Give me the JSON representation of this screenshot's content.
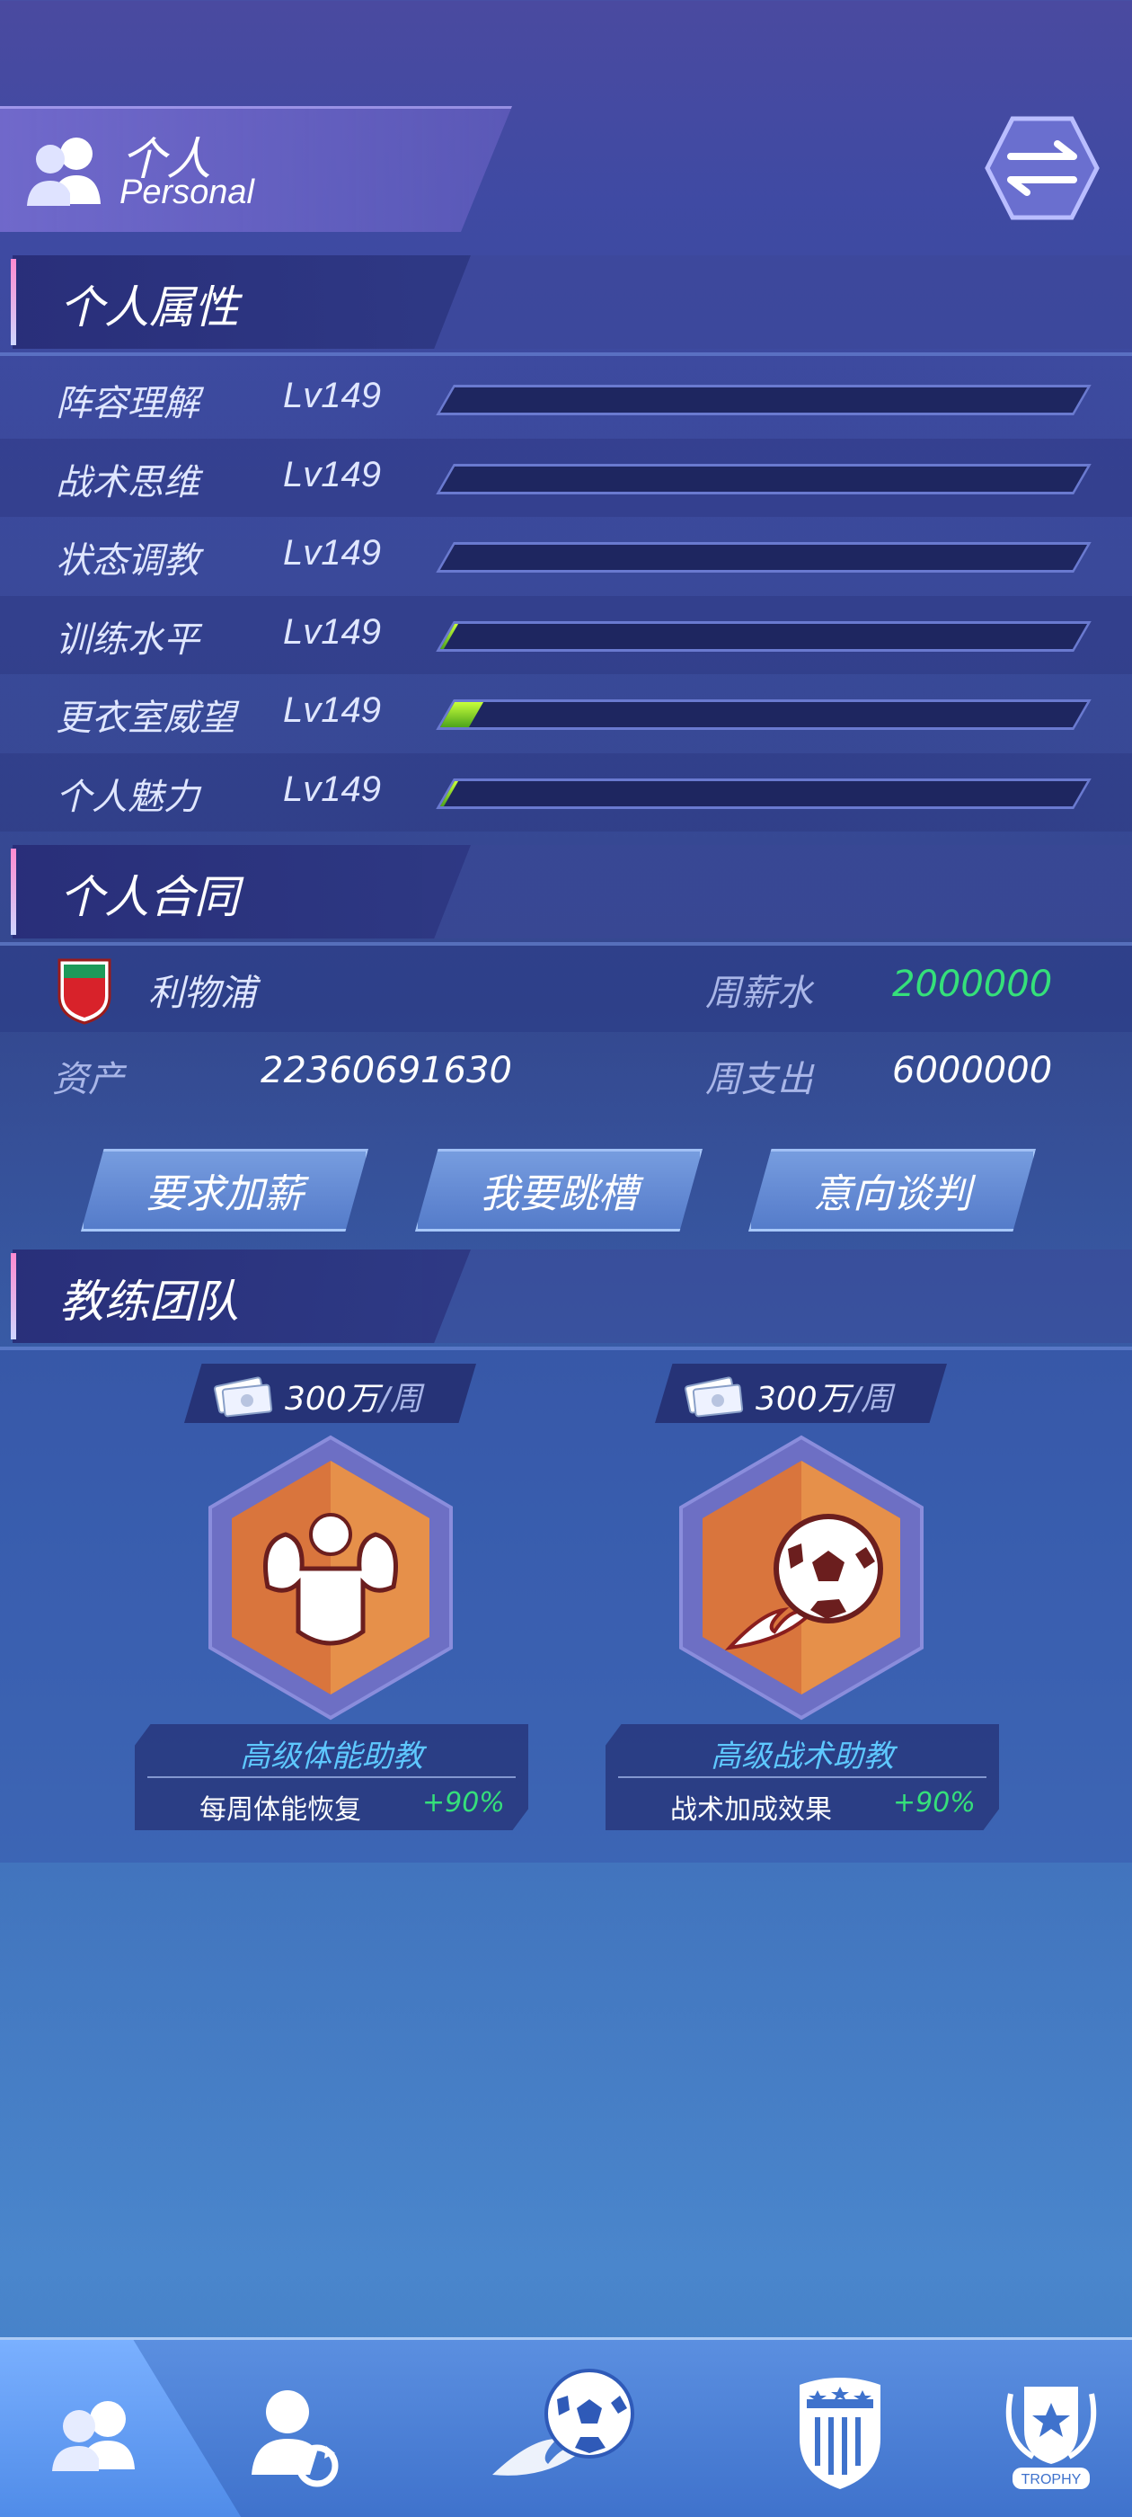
{
  "header": {
    "title": "个人",
    "subtitle": "Personal"
  },
  "sections": {
    "attributes": "个人属性",
    "contract": "个人合同",
    "coaches": "教练团队"
  },
  "attributes": [
    {
      "name": "阵容理解",
      "level": "Lv149",
      "progress": 0.0
    },
    {
      "name": "战术思维",
      "level": "Lv149",
      "progress": 0.0
    },
    {
      "name": "状态调教",
      "level": "Lv149",
      "progress": 0.0
    },
    {
      "name": "训练水平",
      "level": "Lv149",
      "progress": 0.005
    },
    {
      "name": "更衣室威望",
      "level": "Lv149",
      "progress": 0.045
    },
    {
      "name": "个人魅力",
      "level": "Lv149",
      "progress": 0.005
    }
  ],
  "contract": {
    "club": "利物浦",
    "weekly_salary_label": "周薪水",
    "weekly_salary": "2000000",
    "assets_label": "资产",
    "assets": "22360691630",
    "weekly_expense_label": "周支出",
    "weekly_expense": "6000000"
  },
  "actions": {
    "raise": "要求加薪",
    "transfer": "我要跳槽",
    "negotiate": "意向谈判"
  },
  "coaches": [
    {
      "cost": "300万",
      "unit": "/周",
      "name": "高级体能助教",
      "effect": "每周体能恢复",
      "bonus": "+90%",
      "icon": "muscle-icon"
    },
    {
      "cost": "300万",
      "unit": "/周",
      "name": "高级战术助教",
      "effect": "战术加成效果",
      "bonus": "+90%",
      "icon": "fire-football-icon"
    }
  ],
  "bottom_nav": {
    "items": [
      "personal-icon",
      "player-swap-icon",
      "football-icon",
      "club-badge-icon",
      "trophy-icon"
    ],
    "trophy_text": "TROPHY"
  },
  "colors": {
    "accent_green": "#35e07a",
    "coach_title_blue": "#5ec8ff",
    "bar_fill": "#8ee02a"
  }
}
